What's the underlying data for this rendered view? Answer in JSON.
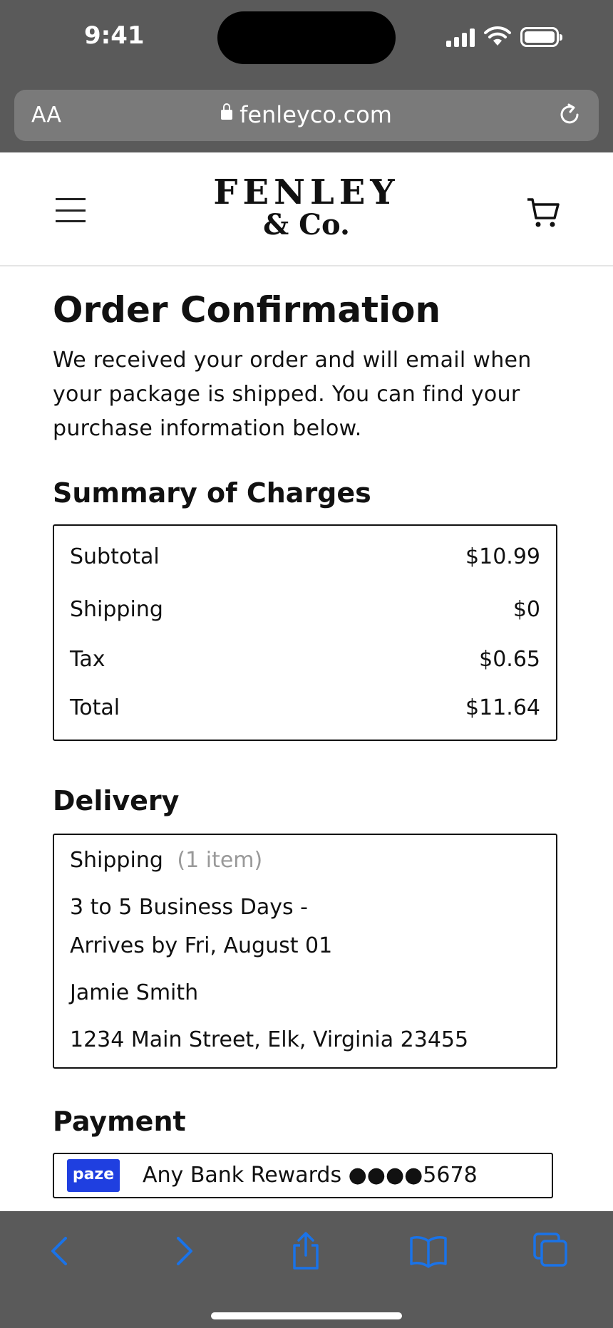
{
  "status_bar": {
    "time": "9:41"
  },
  "browser": {
    "text_size_label": "AA",
    "url": "fenleyco.com"
  },
  "header": {
    "logo_line1": "FENLEY",
    "logo_line2": "& Co."
  },
  "main": {
    "title": "Order Confirmation",
    "intro": "We received your order and will email when your package is shipped. You can find your purchase information below.",
    "summary": {
      "title": "Summary of Charges",
      "rows": [
        {
          "label": "Subtotal",
          "value": "$10.99"
        },
        {
          "label": "Shipping",
          "value": "$0"
        },
        {
          "label": "Tax",
          "value": "$0.65"
        },
        {
          "label": "Total",
          "value": "$11.64"
        }
      ]
    },
    "delivery": {
      "title": "Delivery",
      "method": "Shipping",
      "item_count": "(1 item)",
      "speed_line1": "3 to 5 Business Days -",
      "speed_line2": "Arrives by Fri, August 01",
      "name": "Jamie Smith",
      "address": "1234 Main Street, Elk, Virginia 23455"
    },
    "payment": {
      "title": "Payment",
      "badge": "paze",
      "account": "Any Bank Rewards ●●●●5678"
    }
  },
  "colors": {
    "chrome": "#5a5a5a",
    "toolbar_icons": "#1a73e8",
    "paze_blue": "#1f3fe0"
  }
}
